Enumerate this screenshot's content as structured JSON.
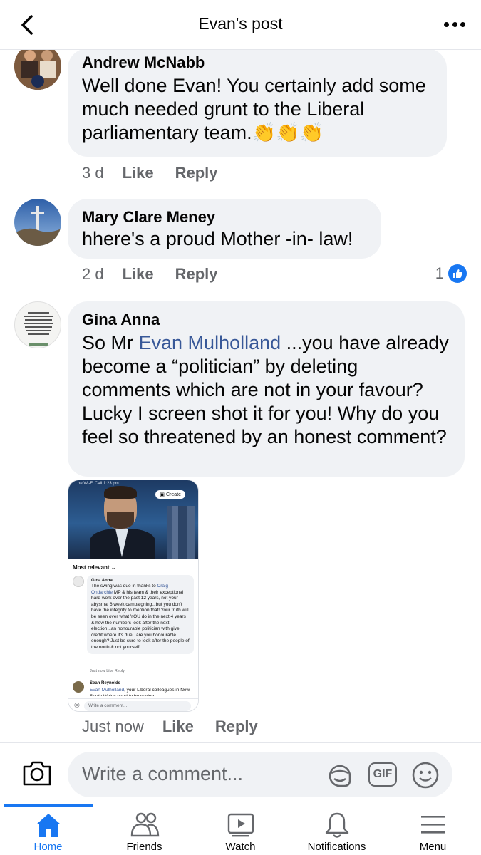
{
  "header": {
    "title": "Evan's post"
  },
  "comments": [
    {
      "author": "Andrew McNabb",
      "text": "Well done Evan! You certainly add some much needed grunt to the Liberal parliamentary team.",
      "emoji": "👏👏👏",
      "time": "3 d",
      "like_label": "Like",
      "reply_label": "Reply"
    },
    {
      "author": "Mary Clare Meney",
      "text": "hhere's a proud Mother -in- law!",
      "time": "2 d",
      "like_label": "Like",
      "reply_label": "Reply",
      "reaction_count": "1"
    },
    {
      "author": "Gina Anna",
      "text_before": "So Mr ",
      "mention": "Evan Mulholland",
      "text_after": " ...you have already become a “politician” by deleting comments which are not in your favour? Lucky I screen shot it for you! Why do you feel so threatened by an honest comment?",
      "time": "Just now",
      "like_label": "Like",
      "reply_label": "Reply",
      "attachment": {
        "status_text": "...ne Wi-Fi Call   1:23 pm",
        "create_label": "Create",
        "sort_label": "Most relevant ⌄",
        "inner_comment": {
          "author": "Gina Anna",
          "text_before": "The swing was due in thanks to ",
          "mention": "Craig Ondarchie",
          "text_after": " MP & his team & their exceptional hard work over the past 12 years, not your abysmal 6 week campaigning...but you don't have the integrity to mention that! Your truth will be seen over what YOU do in the next 4 years & how the numbers look after the next election...an honourable politician with give credit where it's due...are you honourable enough? Just be sure to look after the people of the north & not yourself!",
          "actions": "Just now    Like    Reply"
        },
        "second_comment": {
          "author": "Sean Reynolds",
          "mention": "Evan Mulholland",
          "text": ", your Liberal colleagues in New South Wales need to be paying"
        },
        "composer_placeholder": "Write a comment..."
      }
    }
  ],
  "composer": {
    "placeholder": "Write a comment...",
    "gif_label": "GIF"
  },
  "tabs": [
    {
      "label": "Home",
      "icon": "home-icon",
      "active": true
    },
    {
      "label": "Friends",
      "icon": "friends-icon",
      "active": false
    },
    {
      "label": "Watch",
      "icon": "watch-icon",
      "active": false
    },
    {
      "label": "Notifications",
      "icon": "bell-icon",
      "active": false
    },
    {
      "label": "Menu",
      "icon": "hamburger-icon",
      "active": false
    }
  ],
  "colors": {
    "accent": "#1877f2",
    "mention": "#385898",
    "bubble": "#f0f2f5",
    "secondary_text": "#65676b"
  }
}
